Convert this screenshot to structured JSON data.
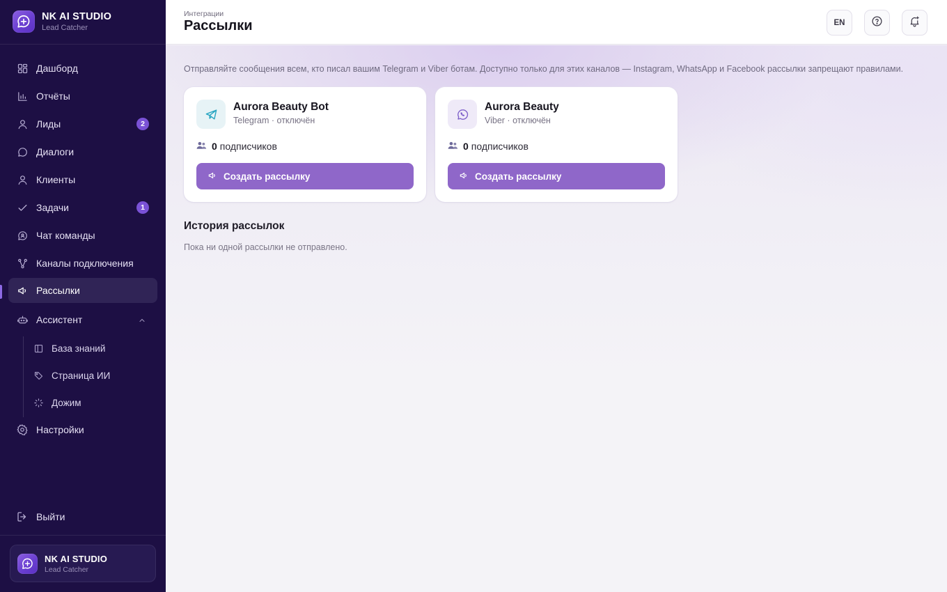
{
  "brand": {
    "title": "NK AI STUDIO",
    "subtitle": "Lead Catcher"
  },
  "sidebar": {
    "items": [
      {
        "label": "Дашборд",
        "icon": "dashboard-icon"
      },
      {
        "label": "Отчёты",
        "icon": "bar-chart-icon"
      },
      {
        "label": "Лиды",
        "icon": "user-icon",
        "badge": "2"
      },
      {
        "label": "Диалоги",
        "icon": "chat-bubble-icon"
      },
      {
        "label": "Клиенты",
        "icon": "user-icon"
      },
      {
        "label": "Задачи",
        "icon": "check-icon",
        "badge": "1"
      },
      {
        "label": "Чат команды",
        "icon": "team-chat-icon"
      },
      {
        "label": "Каналы подключения",
        "icon": "channels-icon"
      },
      {
        "label": "Рассылки",
        "icon": "megaphone-icon",
        "active": true
      },
      {
        "label": "Ассистент",
        "icon": "bot-icon",
        "expanded": true
      }
    ],
    "assistant_sub": [
      {
        "label": "База знаний",
        "icon": "book-icon"
      },
      {
        "label": "Страница ИИ",
        "icon": "tag-icon"
      },
      {
        "label": "Дожим",
        "icon": "loader-icon"
      }
    ],
    "settings_label": "Настройки",
    "logout_label": "Выйти"
  },
  "header": {
    "breadcrumb": "Интеграции",
    "title": "Рассылки",
    "lang_label": "EN"
  },
  "main": {
    "intro": "Отправляйте сообщения всем, кто писал вашим Telegram и Viber ботам. Доступно только для этих каналов — Instagram, WhatsApp и Facebook рассылки запрещают правилами.",
    "cards": [
      {
        "name": "Aurora Beauty Bot",
        "status": "Telegram · отключён",
        "subscribers": "0",
        "subscribers_label": "подписчиков",
        "button_label": "Создать рассылку",
        "icon": "telegram-icon",
        "icon_color": "#2aa6c2",
        "icon_bg": "#e7f3f6"
      },
      {
        "name": "Aurora Beauty",
        "status": "Viber · отключён",
        "subscribers": "0",
        "subscribers_label": "подписчиков",
        "button_label": "Создать рассылку",
        "icon": "viber-icon",
        "icon_color": "#7d5fc9",
        "icon_bg": "#efeaf8"
      }
    ],
    "history_title": "История рассылок",
    "history_empty": "Пока ни одной рассылки не отправлено."
  },
  "colors": {
    "sidebar_bg": "#1d0f44",
    "accent": "#8f67c9",
    "badge": "#7a52d6"
  }
}
